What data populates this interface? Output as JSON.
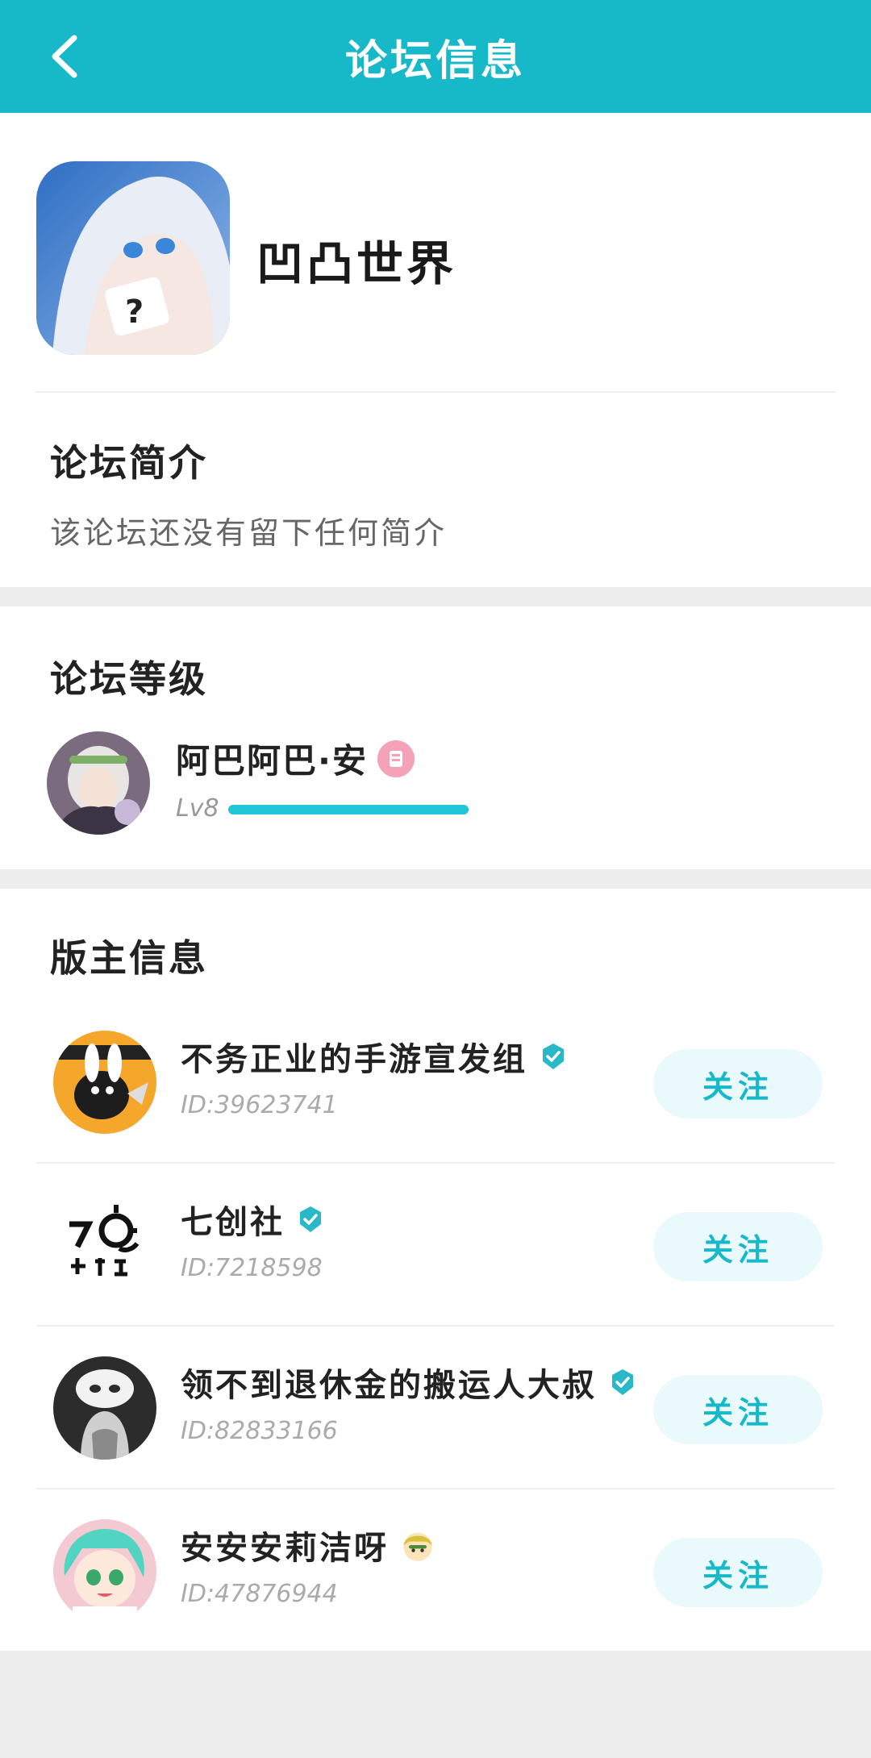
{
  "header": {
    "title": "论坛信息",
    "back_icon": "chevron-left-icon"
  },
  "forum": {
    "name": "凹凸世界",
    "intro_title": "论坛简介",
    "intro_text": "该论坛还没有留下任何简介"
  },
  "level": {
    "title": "论坛等级",
    "user_name": "阿巴阿巴·安",
    "level_label": "Lv8",
    "progress": 1.0
  },
  "moderators": {
    "title": "版主信息",
    "follow_label": "关注",
    "items": [
      {
        "name": "不务正业的手游宣发组",
        "id": "ID:39623741",
        "verified": true
      },
      {
        "name": "七创社",
        "id": "ID:7218598",
        "verified": true
      },
      {
        "name": "领不到退休金的搬运人大叔",
        "id": "ID:82833166",
        "verified": true
      },
      {
        "name": "安安安莉洁呀",
        "id": "ID:47876944",
        "verified": false
      }
    ]
  },
  "colors": {
    "brand": "#17b8c8",
    "follow_bg": "#eaf9fb",
    "progress": "#22c6d6"
  }
}
